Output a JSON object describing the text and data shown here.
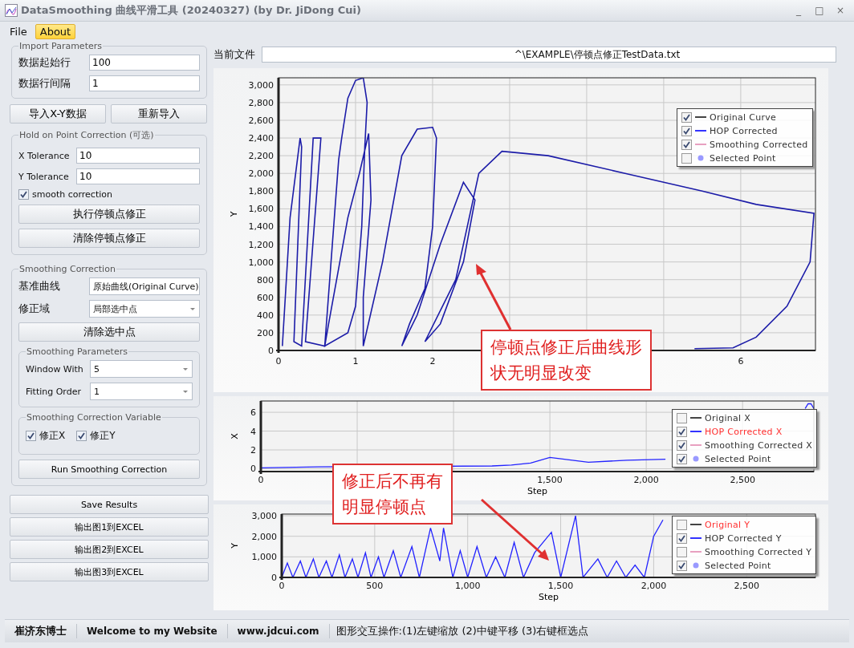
{
  "window": {
    "title": "DataSmoothing 曲线平滑工具 (20240327) (by Dr. JiDong Cui)",
    "controls": [
      "_",
      "□",
      "×"
    ]
  },
  "menu": [
    {
      "label": "File",
      "selected": false
    },
    {
      "label": "About",
      "selected": true
    }
  ],
  "import_parameters": {
    "title": "Import Parameters",
    "fields": [
      {
        "label": "数据起始行",
        "value": "100"
      },
      {
        "label": "数据行间隔",
        "value": "1"
      }
    ]
  },
  "import_buttons": [
    "导入X-Y数据",
    "重新导入"
  ],
  "hold_on_point": {
    "title": "Hold on Point Correction (可选)",
    "fields": [
      {
        "label": "X Tolerance",
        "value": "10"
      },
      {
        "label": "Y Tolerance",
        "value": "10"
      }
    ],
    "checkbox": {
      "label": "smooth correction",
      "checked": true
    },
    "buttons": [
      "执行停顿点修正",
      "清除停顿点修正"
    ]
  },
  "smoothing_correction": {
    "title": "Smoothing Correction",
    "dropdowns": [
      {
        "label": "基准曲线",
        "value": "原始曲线(Original Curve)"
      },
      {
        "label": "修正域",
        "value": "局部选中点"
      }
    ],
    "button": "清除选中点",
    "parameters": {
      "title": "Smoothing Parameters",
      "dropdowns": [
        {
          "label": "Window With",
          "value": "5"
        },
        {
          "label": "Fitting Order",
          "value": "1"
        }
      ]
    },
    "variables": {
      "title": "Smoothing Correction Variable",
      "checkboxes": [
        {
          "label": "修正X",
          "checked": true
        },
        {
          "label": "修正Y",
          "checked": true
        }
      ]
    },
    "run_button": "Run Smoothing Correction"
  },
  "bottom_buttons": [
    "Save Results",
    "输出图1到EXCEL",
    "输出图2到EXCEL",
    "输出图3到EXCEL"
  ],
  "current_file": {
    "label": "当前文件",
    "value": "^\\EXAMPLE\\停顿点修正TestData.txt"
  },
  "charts": [
    {
      "chart_data": {
        "type": "line",
        "grid": true,
        "ylabel": "Y",
        "xlim": [
          0,
          6.97
        ],
        "ylim": [
          0,
          3080
        ],
        "xticks": [
          0,
          1,
          2,
          6
        ],
        "yticks": [
          0,
          200,
          400,
          600,
          800,
          {
            "value": 1000,
            "label": "1,000"
          },
          {
            "value": 1200,
            "label": "1,200"
          },
          {
            "value": 1400,
            "label": "1,400"
          },
          {
            "value": 1600,
            "label": "1,600"
          },
          {
            "value": 1800,
            "label": "1,800"
          },
          {
            "value": 2000,
            "label": "2,000"
          },
          {
            "value": 2200,
            "label": "2,200"
          },
          {
            "value": 2400,
            "label": "2,400"
          },
          {
            "value": 2600,
            "label": "2,600"
          },
          {
            "value": 2800,
            "label": "2,800"
          },
          {
            "value": 3000,
            "label": "3,000"
          }
        ],
        "x": [
          0.05,
          0.15,
          0.28,
          0.3,
          0.2,
          0.3,
          0.45,
          0.55,
          0.35,
          0.6,
          0.78,
          0.82,
          0.9,
          1.0,
          1.1,
          1.15,
          1.12,
          1.08,
          1.0,
          0.9,
          0.6,
          0.65,
          0.9,
          1.05,
          1.17,
          1.2,
          1.1,
          1.1,
          1.35,
          1.6,
          1.8,
          2.0,
          2.05,
          2.0,
          1.9,
          1.7,
          1.6,
          1.8,
          2.1,
          2.4,
          2.55,
          2.4,
          2.1,
          1.9,
          2.3,
          2.6,
          2.9,
          3.5,
          4.5,
          5.5,
          6.2,
          6.95,
          6.9,
          6.6,
          6.2,
          5.9,
          5.4
        ],
        "series": [
          {
            "color": "#1c1ca8",
            "values": [
              50,
              1500,
              2400,
              2300,
              100,
              50,
              2400,
              2400,
              100,
              50,
              2150,
              2400,
              2850,
              3050,
              3080,
              2800,
              2300,
              1400,
              500,
              200,
              50,
              300,
              1500,
              2000,
              2450,
              1700,
              600,
              50,
              1000,
              2200,
              2500,
              2520,
              2400,
              1400,
              700,
              300,
              50,
              400,
              1200,
              1900,
              1700,
              1000,
              300,
              100,
              800,
              2000,
              2250,
              2200,
              2000,
              1800,
              1650,
              1550,
              1000,
              500,
              150,
              30,
              20
            ]
          }
        ]
      },
      "legend": [
        {
          "label": "Original Curve",
          "checked": true,
          "highlighted": false,
          "kind": "line",
          "color": "#444444"
        },
        {
          "label": "HOP Corrected",
          "checked": true,
          "highlighted": false,
          "kind": "line",
          "color": "#3333ff"
        },
        {
          "label": "Smoothing Corrected",
          "checked": true,
          "highlighted": false,
          "kind": "line",
          "color": "#e8a0c0"
        },
        {
          "label": "Selected Point",
          "checked": false,
          "highlighted": false,
          "kind": "point",
          "color": "#9999ff"
        }
      ]
    },
    {
      "chart_data": {
        "type": "line",
        "grid": true,
        "xlabel": "Step",
        "ylabel": "X",
        "xlim": [
          0,
          2870
        ],
        "ylim": [
          -0.3,
          7.2
        ],
        "xticks": [
          0,
          {
            "value": 1500,
            "label": "1,500"
          },
          {
            "value": 2000,
            "label": "2,000"
          },
          {
            "value": 2500,
            "label": "2,500"
          }
        ],
        "yticks": [
          0,
          2,
          4,
          6
        ],
        "x": [
          0,
          300,
          1200,
          1300,
          1400,
          1500,
          1700,
          1900,
          2100,
          2120,
          2825,
          2840,
          2855,
          2870
        ],
        "series": [
          {
            "color": "#2222ff",
            "values": [
              0.1,
              0.2,
              0.3,
              0.4,
              0.6,
              1.2,
              0.7,
              0.9,
              1.0,
              null,
              6.4,
              6.9,
              6.9,
              6.4
            ]
          }
        ]
      },
      "legend": [
        {
          "label": "Original X",
          "checked": false,
          "highlighted": false,
          "kind": "line",
          "color": "#444444"
        },
        {
          "label": "HOP Corrected X",
          "checked": true,
          "highlighted": true,
          "kind": "line",
          "color": "#3333ff"
        },
        {
          "label": "Smoothing Corrected X",
          "checked": true,
          "highlighted": false,
          "kind": "line",
          "color": "#e8a0c0"
        },
        {
          "label": "Selected Point",
          "checked": true,
          "highlighted": false,
          "kind": "point",
          "color": "#9999ff"
        }
      ]
    },
    {
      "chart_data": {
        "type": "line",
        "grid": true,
        "xlabel": "Step",
        "ylabel": "Y",
        "xlim": [
          0,
          2870
        ],
        "ylim": [
          0,
          3080
        ],
        "xticks": [
          0,
          500,
          {
            "value": 1000,
            "label": "1,000"
          },
          {
            "value": 1500,
            "label": "1,500"
          },
          {
            "value": 2000,
            "label": "2,000"
          },
          {
            "value": 2500,
            "label": "2,500"
          }
        ],
        "yticks": [
          0,
          {
            "value": 1000,
            "label": "1,000"
          },
          {
            "value": 2000,
            "label": "2,000"
          },
          {
            "value": 3000,
            "label": "3,000"
          }
        ],
        "x": [
          0,
          30,
          60,
          100,
          130,
          170,
          200,
          240,
          270,
          310,
          340,
          380,
          410,
          450,
          480,
          520,
          550,
          600,
          640,
          700,
          740,
          800,
          850,
          870,
          920,
          960,
          1000,
          1050,
          1100,
          1150,
          1200,
          1250,
          1300,
          1360,
          1450,
          1500,
          1580,
          1620,
          1700,
          1750,
          1800,
          1850,
          1900,
          1950,
          2000,
          2050
        ],
        "series": [
          {
            "color": "#2222ff",
            "values": [
              0,
              700,
              0,
              800,
              0,
              900,
              0,
              800,
              0,
              1100,
              0,
              900,
              0,
              1200,
              0,
              1000,
              0,
              1300,
              0,
              1500,
              0,
              2400,
              800,
              2400,
              0,
              1300,
              0,
              1500,
              0,
              1000,
              0,
              1700,
              0,
              1200,
              2200,
              0,
              3000,
              0,
              900,
              0,
              800,
              0,
              600,
              0,
              2000,
              2800
            ]
          }
        ]
      },
      "legend": [
        {
          "label": "Original Y",
          "checked": false,
          "highlighted": true,
          "kind": "line",
          "color": "#444444"
        },
        {
          "label": "HOP Corrected Y",
          "checked": true,
          "highlighted": false,
          "kind": "line",
          "color": "#3333ff"
        },
        {
          "label": "Smoothing Corrected Y",
          "checked": false,
          "highlighted": false,
          "kind": "line",
          "color": "#e8a0c0"
        },
        {
          "label": "Selected Point",
          "checked": true,
          "highlighted": false,
          "kind": "point",
          "color": "#9999ff"
        }
      ]
    }
  ],
  "callouts": [
    {
      "text": "停顿点修正后曲线形状无明显改变"
    },
    {
      "text": "修正后不再有明显停顿点"
    }
  ],
  "status_bar": [
    {
      "text": "崔济东博士",
      "kind": "bold"
    },
    {
      "text": "Welcome to my Website",
      "kind": "bold"
    },
    {
      "text": "www.jdcui.com",
      "kind": "bold"
    },
    {
      "text": "图形交互操作:(1)左键缩放 (2)中键平移 (3)右键框选点",
      "kind": "plain"
    }
  ]
}
